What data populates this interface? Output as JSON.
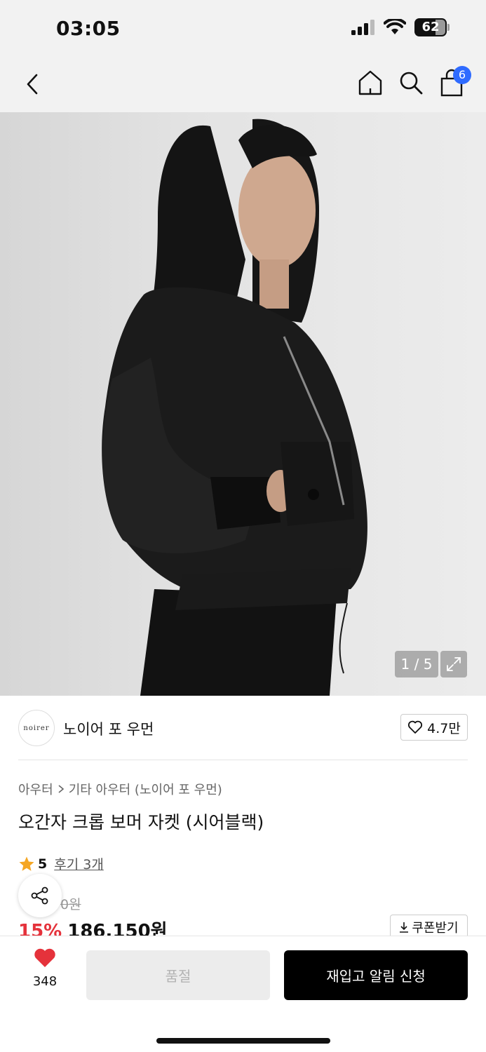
{
  "status": {
    "time": "03:05",
    "battery": "62"
  },
  "nav": {
    "cart_count": "6",
    "icons": [
      "back-icon",
      "home-icon",
      "search-icon",
      "cart-icon"
    ]
  },
  "gallery": {
    "counter": "1 / 5"
  },
  "brand": {
    "logo_text": "noirer",
    "name": "노이어 포 우먼",
    "likes": "4.7만"
  },
  "product": {
    "breadcrumb": [
      "아우터",
      "기타 아우터 (노이어 포 우먼)"
    ],
    "title": "오간자 크롭 보머 자켓 (시어블랙)",
    "rating": "5",
    "reviews": "후기 3개",
    "original_price_visible": "0원",
    "discount": "15%",
    "price": "186,150원",
    "coupon_label": "쿠폰받기"
  },
  "bottom": {
    "wish_count": "348",
    "soldout_label": "품절",
    "restock_label": "재입고 알림 신청"
  },
  "colors": {
    "accent_red": "#e5323b",
    "badge_blue": "#2f6bff",
    "star": "#f5a623"
  }
}
